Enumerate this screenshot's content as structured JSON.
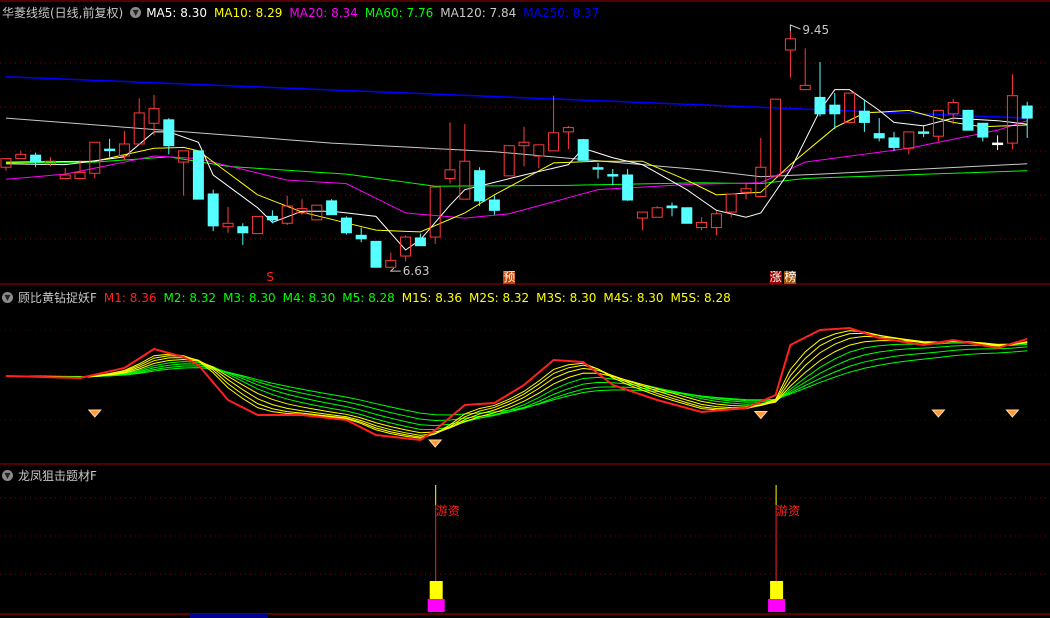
{
  "colors": {
    "up": "#ff3a3a",
    "down": "#55ffff",
    "grid": "#8a0000",
    "ma5": "#ffffff",
    "ma10": "#ffff00",
    "ma20": "#ff00ff",
    "ma60": "#00ff00",
    "ma120": "#c8c8c8",
    "ma250": "#0000ff",
    "m1": "#ff2020",
    "mgreen": "#00ff00",
    "myellow": "#ffff00"
  },
  "main": {
    "title": "华菱线缆(日线,前复权)",
    "legend": [
      {
        "label": "MA5: 8.30",
        "color": "#ffffff"
      },
      {
        "label": "MA10: 8.29",
        "color": "#ffff00"
      },
      {
        "label": "MA20: 8.34",
        "color": "#ff00ff"
      },
      {
        "label": "MA60: 7.76",
        "color": "#00ff00"
      },
      {
        "label": "MA120: 7.84",
        "color": "#c8c8c8"
      },
      {
        "label": "MA250: 8.37",
        "color": "#0000ff"
      }
    ],
    "high_label": "9.45",
    "low_label": "6.63",
    "markers": [
      {
        "index": 18,
        "text": "S",
        "color": "#ff2020",
        "bg": "transparent"
      },
      {
        "index": 34,
        "text": "预",
        "color": "#ffffff",
        "bg": "#c04000"
      },
      {
        "index": 52,
        "text": "涨",
        "color": "#ffffff",
        "bg": "#a00000"
      },
      {
        "index": 53,
        "text": "榜",
        "color": "#ffffff",
        "bg": "#a05000"
      }
    ]
  },
  "indicator1": {
    "title": "顾比黄钻捉妖F",
    "legend": [
      {
        "label": "M1: 8.36",
        "color": "#ff2020"
      },
      {
        "label": "M2: 8.32",
        "color": "#00ff00"
      },
      {
        "label": "M3: 8.30",
        "color": "#00ff00"
      },
      {
        "label": "M4: 8.30",
        "color": "#00ff00"
      },
      {
        "label": "M5: 8.28",
        "color": "#00ff00"
      },
      {
        "label": "M1S: 8.36",
        "color": "#ffff00"
      },
      {
        "label": "M2S: 8.32",
        "color": "#ffff00"
      },
      {
        "label": "M3S: 8.30",
        "color": "#ffff00"
      },
      {
        "label": "M4S: 8.30",
        "color": "#ffff00"
      },
      {
        "label": "M5S: 8.28",
        "color": "#ffff00"
      }
    ],
    "diamonds": [
      6,
      29,
      51,
      63,
      68
    ]
  },
  "indicator2": {
    "title": "龙凤狙击题材F",
    "signals": [
      {
        "index": 29,
        "text": "游资"
      },
      {
        "index": 52,
        "text": "游资"
      }
    ]
  },
  "chart_data": {
    "type": "candlestick",
    "price_range": [
      6.63,
      9.45
    ],
    "candles": [
      [
        7.8,
        7.9,
        7.9,
        7.76
      ],
      [
        7.9,
        7.95,
        7.99,
        7.9
      ],
      [
        7.94,
        7.86,
        7.97,
        7.8
      ],
      [
        7.84,
        7.87,
        7.92,
        7.81
      ],
      [
        7.67,
        7.71,
        7.79,
        7.67
      ],
      [
        7.67,
        7.74,
        7.88,
        7.67
      ],
      [
        7.73,
        8.09,
        8.09,
        7.67
      ],
      [
        8.01,
        8.0,
        8.13,
        7.92
      ],
      [
        7.93,
        8.07,
        8.22,
        7.88
      ],
      [
        8.07,
        8.43,
        8.6,
        8.07
      ],
      [
        8.31,
        8.48,
        8.64,
        8.17
      ],
      [
        8.35,
        8.05,
        8.37,
        7.95
      ],
      [
        7.86,
        7.99,
        7.99,
        7.47
      ],
      [
        7.99,
        7.43,
        7.99,
        7.43
      ],
      [
        7.49,
        7.12,
        7.54,
        7.06
      ],
      [
        7.11,
        7.15,
        7.34,
        7.04
      ],
      [
        7.11,
        7.04,
        7.15,
        6.9
      ],
      [
        7.03,
        7.23,
        7.23,
        7.03
      ],
      [
        7.23,
        7.19,
        7.3,
        7.15
      ],
      [
        7.15,
        7.35,
        7.47,
        7.13
      ],
      [
        7.27,
        7.32,
        7.43,
        7.25
      ],
      [
        7.19,
        7.36,
        7.36,
        7.19
      ],
      [
        7.41,
        7.25,
        7.43,
        7.25
      ],
      [
        7.21,
        7.04,
        7.23,
        7.02
      ],
      [
        7.01,
        6.97,
        7.1,
        6.93
      ],
      [
        6.94,
        6.64,
        6.94,
        6.64
      ],
      [
        6.64,
        6.72,
        6.81,
        6.63
      ],
      [
        6.77,
        6.99,
        7.01,
        6.71
      ],
      [
        6.98,
        6.89,
        7.03,
        6.89
      ],
      [
        6.99,
        7.57,
        7.57,
        6.91
      ],
      [
        7.67,
        7.77,
        8.32,
        7.61
      ],
      [
        7.43,
        7.87,
        8.3,
        7.43
      ],
      [
        7.76,
        7.41,
        7.8,
        7.35
      ],
      [
        7.42,
        7.3,
        7.47,
        7.25
      ],
      [
        7.7,
        8.05,
        8.05,
        7.7
      ],
      [
        8.05,
        8.09,
        8.27,
        7.81
      ],
      [
        7.93,
        8.06,
        8.06,
        7.79
      ],
      [
        7.99,
        8.2,
        8.63,
        7.99
      ],
      [
        8.21,
        8.26,
        8.28,
        8.01
      ],
      [
        8.12,
        7.88,
        8.13,
        7.88
      ],
      [
        7.795,
        7.79,
        7.85,
        7.67
      ],
      [
        7.715,
        7.71,
        7.78,
        7.59
      ],
      [
        7.71,
        7.42,
        7.78,
        7.41
      ],
      [
        7.21,
        7.28,
        7.28,
        7.07
      ],
      [
        7.22,
        7.33,
        7.35,
        7.22
      ],
      [
        7.35,
        7.33,
        7.39,
        7.23
      ],
      [
        7.33,
        7.15,
        7.33,
        7.15
      ],
      [
        7.1,
        7.16,
        7.22,
        7.07
      ],
      [
        7.1,
        7.26,
        7.29,
        7.01
      ],
      [
        7.28,
        7.49,
        7.49,
        7.22
      ],
      [
        7.51,
        7.55,
        7.62,
        7.43
      ],
      [
        7.46,
        7.8,
        8.14,
        7.46
      ],
      [
        7.7,
        8.59,
        8.59,
        7.7
      ],
      [
        9.16,
        9.29,
        9.45,
        8.84
      ],
      [
        8.7,
        8.75,
        9.18,
        8.7
      ],
      [
        8.61,
        8.42,
        9.02,
        8.39
      ],
      [
        8.52,
        8.42,
        8.66,
        8.24
      ],
      [
        8.32,
        8.66,
        8.66,
        8.32
      ],
      [
        8.45,
        8.32,
        8.58,
        8.21
      ],
      [
        8.19,
        8.14,
        8.37,
        8.1
      ],
      [
        8.14,
        8.03,
        8.21,
        7.99
      ],
      [
        8.02,
        8.21,
        8.21,
        7.95
      ],
      [
        8.21,
        8.21,
        8.29,
        8.15
      ],
      [
        8.16,
        8.46,
        8.46,
        8.1
      ],
      [
        8.42,
        8.55,
        8.59,
        8.3
      ],
      [
        8.46,
        8.23,
        8.46,
        8.23
      ],
      [
        8.31,
        8.15,
        8.31,
        8.1
      ],
      [
        8.08,
        8.08,
        8.17,
        8.0
      ],
      [
        8.08,
        8.63,
        8.88,
        8.01
      ],
      [
        8.51,
        8.37,
        8.56,
        8.14
      ]
    ],
    "ma": {
      "ma250": [
        [
          0,
          8.85
        ],
        [
          69,
          8.37
        ]
      ],
      "ma120": [
        [
          0,
          8.37
        ],
        [
          22,
          8.08
        ],
        [
          33,
          7.98
        ],
        [
          47,
          7.77
        ],
        [
          51,
          7.69
        ],
        [
          55,
          7.72
        ],
        [
          69,
          7.84
        ]
      ],
      "ma60": [
        [
          0,
          7.85
        ],
        [
          6,
          7.86
        ],
        [
          11,
          7.92
        ],
        [
          15,
          7.81
        ],
        [
          23,
          7.72
        ],
        [
          29,
          7.58
        ],
        [
          38,
          7.59
        ],
        [
          47,
          7.62
        ],
        [
          51,
          7.61
        ],
        [
          54,
          7.67
        ],
        [
          69,
          7.76
        ]
      ],
      "ma20": [
        [
          0,
          7.66
        ],
        [
          4,
          7.72
        ],
        [
          10,
          7.93
        ],
        [
          13,
          7.9
        ],
        [
          19,
          7.65
        ],
        [
          23,
          7.61
        ],
        [
          27,
          7.27
        ],
        [
          31,
          7.21
        ],
        [
          34,
          7.26
        ],
        [
          40,
          7.54
        ],
        [
          46,
          7.6
        ],
        [
          51,
          7.62
        ],
        [
          54,
          7.86
        ],
        [
          61,
          8.02
        ],
        [
          67,
          8.23
        ],
        [
          69,
          8.34
        ]
      ],
      "ma10": [
        [
          0,
          7.86
        ],
        [
          6,
          7.87
        ],
        [
          10,
          8.02
        ],
        [
          12,
          8.03
        ],
        [
          13,
          7.99
        ],
        [
          17,
          7.48
        ],
        [
          20,
          7.28
        ],
        [
          25,
          7.07
        ],
        [
          28,
          7.05
        ],
        [
          31,
          7.27
        ],
        [
          33,
          7.48
        ],
        [
          37,
          7.85
        ],
        [
          40,
          7.87
        ],
        [
          43,
          7.87
        ],
        [
          46,
          7.65
        ],
        [
          48,
          7.48
        ],
        [
          51,
          7.51
        ],
        [
          53,
          7.83
        ],
        [
          56,
          8.26
        ],
        [
          58,
          8.43
        ],
        [
          61,
          8.46
        ],
        [
          64,
          8.32
        ],
        [
          66,
          8.27
        ],
        [
          69,
          8.29
        ]
      ],
      "ma5": [
        [
          0,
          7.84
        ],
        [
          4,
          7.83
        ],
        [
          8,
          7.92
        ],
        [
          10,
          8.21
        ],
        [
          11,
          8.21
        ],
        [
          13,
          8.09
        ],
        [
          14,
          7.71
        ],
        [
          17,
          7.33
        ],
        [
          18,
          7.16
        ],
        [
          20,
          7.29
        ],
        [
          22,
          7.29
        ],
        [
          25,
          7.23
        ],
        [
          27,
          6.84
        ],
        [
          28,
          6.96
        ],
        [
          30,
          7.36
        ],
        [
          31,
          7.54
        ],
        [
          35,
          7.71
        ],
        [
          38,
          7.83
        ],
        [
          39,
          8.02
        ],
        [
          41,
          7.91
        ],
        [
          43,
          7.83
        ],
        [
          46,
          7.54
        ],
        [
          48,
          7.3
        ],
        [
          50,
          7.22
        ],
        [
          51,
          7.27
        ],
        [
          53,
          7.77
        ],
        [
          55,
          8.46
        ],
        [
          56,
          8.7
        ],
        [
          57,
          8.7
        ],
        [
          59,
          8.46
        ],
        [
          60,
          8.32
        ],
        [
          62,
          8.28
        ],
        [
          64,
          8.37
        ],
        [
          67,
          8.34
        ],
        [
          69,
          8.3
        ]
      ]
    },
    "m1": [
      [
        0,
        7.99
      ],
      [
        5,
        7.97
      ],
      [
        8,
        8.07
      ],
      [
        10,
        8.26
      ],
      [
        12,
        8.18
      ],
      [
        13,
        8.1
      ],
      [
        15,
        7.75
      ],
      [
        17,
        7.6
      ],
      [
        20,
        7.6
      ],
      [
        23,
        7.55
      ],
      [
        25,
        7.4
      ],
      [
        28,
        7.35
      ],
      [
        29,
        7.45
      ],
      [
        31,
        7.7
      ],
      [
        33,
        7.72
      ],
      [
        35,
        7.9
      ],
      [
        37,
        8.15
      ],
      [
        39,
        8.13
      ],
      [
        41,
        7.9
      ],
      [
        44,
        7.75
      ],
      [
        47,
        7.63
      ],
      [
        50,
        7.67
      ],
      [
        52,
        7.8
      ],
      [
        53,
        8.3
      ],
      [
        55,
        8.45
      ],
      [
        57,
        8.47
      ],
      [
        59,
        8.37
      ],
      [
        62,
        8.3
      ],
      [
        64,
        8.35
      ],
      [
        67,
        8.27
      ],
      [
        69,
        8.36
      ]
    ]
  }
}
